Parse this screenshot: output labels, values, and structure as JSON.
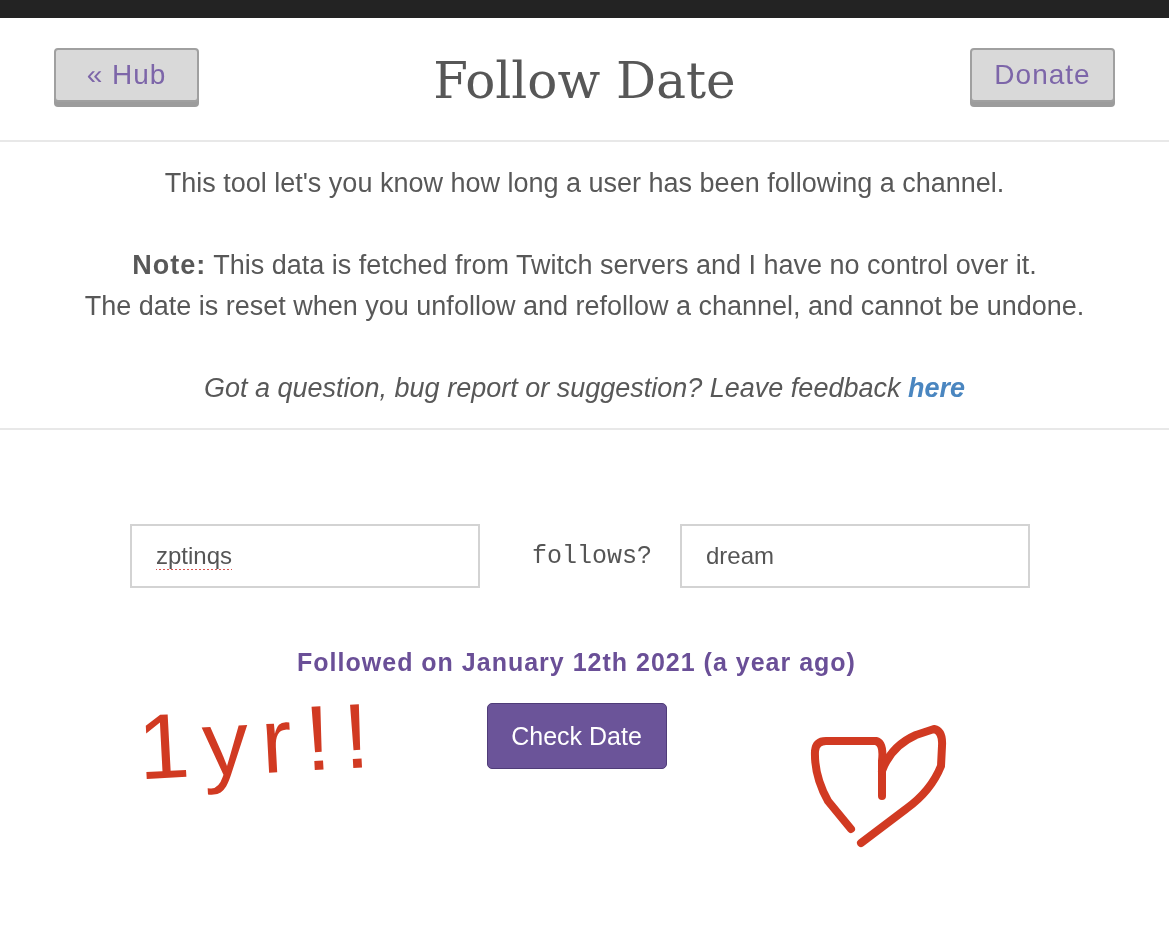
{
  "header": {
    "left_button": "« Hub",
    "title": "Follow Date",
    "right_button": "Donate"
  },
  "intro": {
    "description": "This tool let's you know how long a user has been following a channel.",
    "note": [
      "**Note:** This data is fetched from Twitch servers and I have no control over it.",
      "The date is reset when you unfollow and refollow a channel, and cannot be undone."
    ],
    "feedback": {
      "text": "Got a question, bug report or suggestion? Leave feedback",
      "link": "here"
    }
  },
  "form": {
    "user_field": {
      "value": "zptinqs",
      "misspelled": true
    },
    "connector": "follows?",
    "channel_field": {
      "value": "dream",
      "misspelled": false
    },
    "result": "Followed on January 12th 2021 (a year ago)",
    "button": "Check Date"
  },
  "annotations": [
    {
      "kind": "text",
      "text": "1yr!!"
    },
    {
      "kind": "heart"
    }
  ]
}
